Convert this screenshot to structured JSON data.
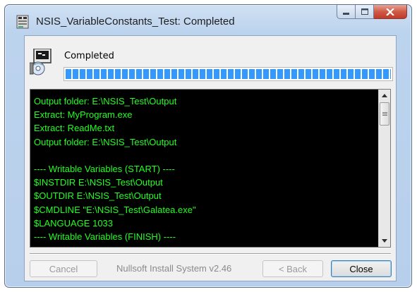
{
  "window": {
    "title": "NSIS_VariableConstants_Test: Completed"
  },
  "header": {
    "status_text": "Completed",
    "progress_fraction": 1.0
  },
  "log": {
    "lines": [
      "Output folder: E:\\NSIS_Test\\Output",
      "Extract: MyProgram.exe",
      "Extract: ReadMe.txt",
      "Output folder: E:\\NSIS_Test\\Output",
      "",
      "---- Writable Variables (START) ----",
      "$INSTDIR E:\\NSIS_Test\\Output",
      "$OUTDIR E:\\NSIS_Test\\Output",
      "$CMDLINE \"E:\\NSIS_Test\\Galatea.exe\"",
      "$LANGUAGE 1033",
      "---- Writable Variables (FINISH) ----"
    ],
    "text_color": "#20ff20",
    "background": "#000000"
  },
  "footer": {
    "cancel_label": "Cancel",
    "branding": "Nullsoft Install System v2.46",
    "back_label": "< Back",
    "close_label": "Close"
  },
  "icons": {
    "title": "installer-icon",
    "header": "installer-disc-icon",
    "minimize": "minimize-icon",
    "maximize": "maximize-icon",
    "close": "close-icon"
  }
}
